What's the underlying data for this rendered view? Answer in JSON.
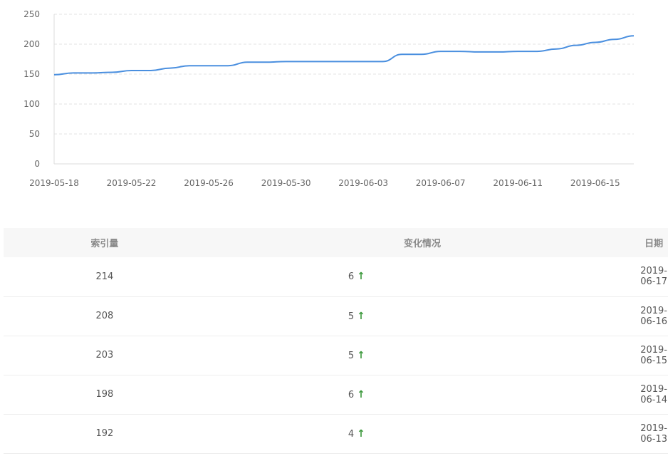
{
  "chart_data": {
    "type": "line",
    "x": [
      "2019-05-18",
      "2019-05-19",
      "2019-05-20",
      "2019-05-21",
      "2019-05-22",
      "2019-05-23",
      "2019-05-24",
      "2019-05-25",
      "2019-05-26",
      "2019-05-27",
      "2019-05-28",
      "2019-05-29",
      "2019-05-30",
      "2019-05-31",
      "2019-06-01",
      "2019-06-02",
      "2019-06-03",
      "2019-06-04",
      "2019-06-05",
      "2019-06-06",
      "2019-06-07",
      "2019-06-08",
      "2019-06-09",
      "2019-06-10",
      "2019-06-11",
      "2019-06-12",
      "2019-06-13",
      "2019-06-14",
      "2019-06-15",
      "2019-06-16",
      "2019-06-17"
    ],
    "series": [
      {
        "values": [
          149,
          152,
          152,
          153,
          156,
          156,
          160,
          164,
          164,
          164,
          170,
          170,
          171,
          171,
          171,
          171,
          171,
          171,
          183,
          183,
          188,
          188,
          187,
          187,
          188,
          188,
          192,
          198,
          203,
          208,
          214
        ],
        "color": "#4a8fdf"
      }
    ],
    "xticks": [
      "2019-05-18",
      "2019-05-22",
      "2019-05-26",
      "2019-05-30",
      "2019-06-03",
      "2019-06-07",
      "2019-06-11",
      "2019-06-15"
    ],
    "yticks": [
      "0",
      "50",
      "100",
      "150",
      "200",
      "250"
    ],
    "ylim": [
      0,
      250
    ],
    "grid": true
  },
  "table": {
    "headers": [
      "索引量",
      "变化情况",
      "日期"
    ],
    "rows": [
      {
        "index": "214",
        "change": "6",
        "date": "2019-06-17"
      },
      {
        "index": "208",
        "change": "5",
        "date": "2019-06-16"
      },
      {
        "index": "203",
        "change": "5",
        "date": "2019-06-15"
      },
      {
        "index": "198",
        "change": "6",
        "date": "2019-06-14"
      },
      {
        "index": "192",
        "change": "4",
        "date": "2019-06-13"
      }
    ],
    "arrow_icon": "arrow-up-icon",
    "arrow_color": "#3f9a3f"
  }
}
